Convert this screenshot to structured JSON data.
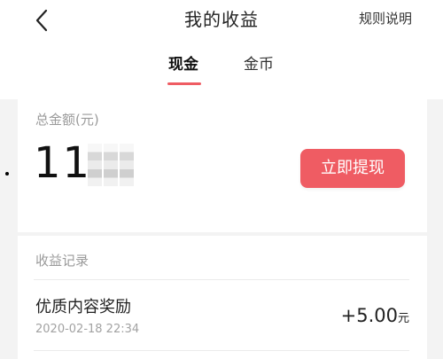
{
  "header": {
    "title": "我的收益",
    "rules_label": "规则说明",
    "back_icon": "chevron-left-icon"
  },
  "tabs": [
    {
      "label": "现金",
      "active": true
    },
    {
      "label": "金币",
      "active": false
    }
  ],
  "summary": {
    "label": "总金额(元)",
    "amount_text": "11  0",
    "withdraw_label": "立即提现"
  },
  "records": {
    "title": "收益记录",
    "items": [
      {
        "name": "优质内容奖励",
        "time": "2020-02-18 22:34",
        "amount": "+5.00",
        "unit": "元"
      }
    ]
  },
  "colors": {
    "accent": "#ef5c63",
    "muted_text": "#9a9a9a",
    "background": "#f3f3f3"
  }
}
